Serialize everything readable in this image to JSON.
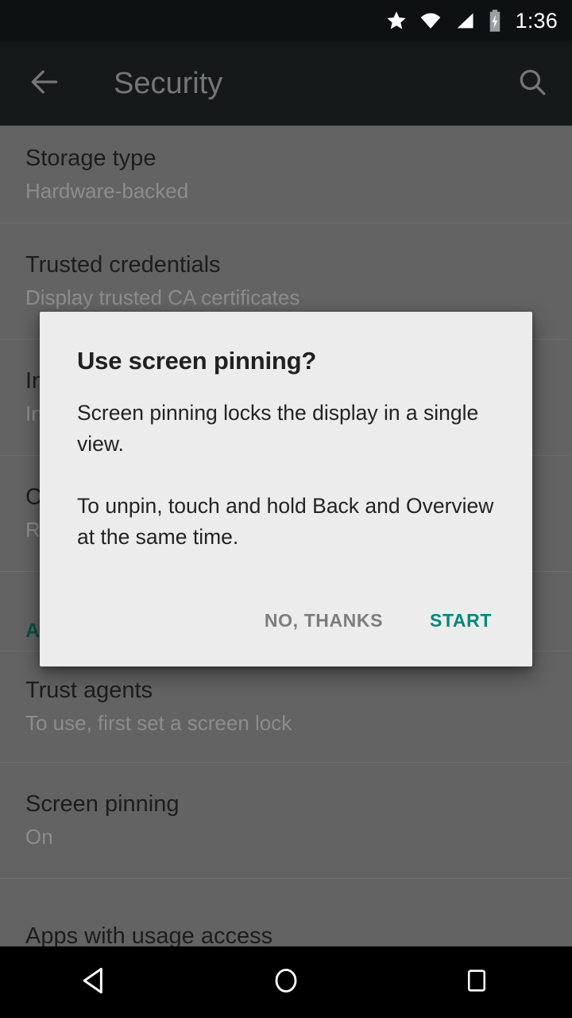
{
  "status_bar": {
    "time": "1:36",
    "icons": [
      "star-icon",
      "wifi-icon",
      "cell-signal-icon",
      "battery-charging-icon"
    ]
  },
  "action_bar": {
    "title": "Security",
    "back_icon": "arrow-back-icon",
    "search_icon": "search-icon"
  },
  "settings_list": [
    {
      "title": "Storage type",
      "summary": "Hardware-backed"
    },
    {
      "title": "Trusted credentials",
      "summary": "Display trusted CA certificates"
    },
    {
      "title": "Install from SD card",
      "summary": "Install certificates from SD card"
    },
    {
      "title": "Clear credentials",
      "summary": "Remove all certificates"
    },
    {
      "section": "ADVANCED"
    },
    {
      "title": "Trust agents",
      "summary": "To use, first set a screen lock"
    },
    {
      "title": "Screen pinning",
      "summary": "On"
    },
    {
      "title": "Apps with usage access",
      "summary": ""
    }
  ],
  "dialog": {
    "title": "Use screen pinning?",
    "paragraph_1": "Screen pinning locks the display in a single view.",
    "paragraph_2": "To unpin, touch and hold Back and Overview at the same time.",
    "negative_button": "NO, THANKS",
    "positive_button": "START"
  },
  "nav_bar": {
    "back": "back-triangle-icon",
    "home": "home-circle-icon",
    "overview": "overview-square-icon"
  },
  "colors": {
    "accent_teal": "#00897b",
    "dialog_background": "#ececec",
    "scrim_list": "#636363",
    "status_bar": "#0e1112",
    "action_bar": "#16191a"
  }
}
